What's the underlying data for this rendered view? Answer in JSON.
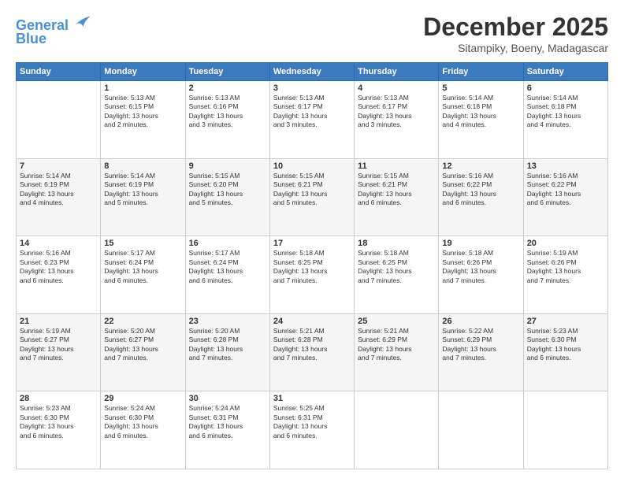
{
  "header": {
    "logo_line1": "General",
    "logo_line2": "Blue",
    "month": "December 2025",
    "location": "Sitampiky, Boeny, Madagascar"
  },
  "weekdays": [
    "Sunday",
    "Monday",
    "Tuesday",
    "Wednesday",
    "Thursday",
    "Friday",
    "Saturday"
  ],
  "weeks": [
    [
      {
        "day": "",
        "info": ""
      },
      {
        "day": "1",
        "info": "Sunrise: 5:13 AM\nSunset: 6:15 PM\nDaylight: 13 hours\nand 2 minutes."
      },
      {
        "day": "2",
        "info": "Sunrise: 5:13 AM\nSunset: 6:16 PM\nDaylight: 13 hours\nand 3 minutes."
      },
      {
        "day": "3",
        "info": "Sunrise: 5:13 AM\nSunset: 6:17 PM\nDaylight: 13 hours\nand 3 minutes."
      },
      {
        "day": "4",
        "info": "Sunrise: 5:13 AM\nSunset: 6:17 PM\nDaylight: 13 hours\nand 3 minutes."
      },
      {
        "day": "5",
        "info": "Sunrise: 5:14 AM\nSunset: 6:18 PM\nDaylight: 13 hours\nand 4 minutes."
      },
      {
        "day": "6",
        "info": "Sunrise: 5:14 AM\nSunset: 6:18 PM\nDaylight: 13 hours\nand 4 minutes."
      }
    ],
    [
      {
        "day": "7",
        "info": "Sunrise: 5:14 AM\nSunset: 6:19 PM\nDaylight: 13 hours\nand 4 minutes."
      },
      {
        "day": "8",
        "info": "Sunrise: 5:14 AM\nSunset: 6:19 PM\nDaylight: 13 hours\nand 5 minutes."
      },
      {
        "day": "9",
        "info": "Sunrise: 5:15 AM\nSunset: 6:20 PM\nDaylight: 13 hours\nand 5 minutes."
      },
      {
        "day": "10",
        "info": "Sunrise: 5:15 AM\nSunset: 6:21 PM\nDaylight: 13 hours\nand 5 minutes."
      },
      {
        "day": "11",
        "info": "Sunrise: 5:15 AM\nSunset: 6:21 PM\nDaylight: 13 hours\nand 6 minutes."
      },
      {
        "day": "12",
        "info": "Sunrise: 5:16 AM\nSunset: 6:22 PM\nDaylight: 13 hours\nand 6 minutes."
      },
      {
        "day": "13",
        "info": "Sunrise: 5:16 AM\nSunset: 6:22 PM\nDaylight: 13 hours\nand 6 minutes."
      }
    ],
    [
      {
        "day": "14",
        "info": "Sunrise: 5:16 AM\nSunset: 6:23 PM\nDaylight: 13 hours\nand 6 minutes."
      },
      {
        "day": "15",
        "info": "Sunrise: 5:17 AM\nSunset: 6:24 PM\nDaylight: 13 hours\nand 6 minutes."
      },
      {
        "day": "16",
        "info": "Sunrise: 5:17 AM\nSunset: 6:24 PM\nDaylight: 13 hours\nand 6 minutes."
      },
      {
        "day": "17",
        "info": "Sunrise: 5:18 AM\nSunset: 6:25 PM\nDaylight: 13 hours\nand 7 minutes."
      },
      {
        "day": "18",
        "info": "Sunrise: 5:18 AM\nSunset: 6:25 PM\nDaylight: 13 hours\nand 7 minutes."
      },
      {
        "day": "19",
        "info": "Sunrise: 5:18 AM\nSunset: 6:26 PM\nDaylight: 13 hours\nand 7 minutes."
      },
      {
        "day": "20",
        "info": "Sunrise: 5:19 AM\nSunset: 6:26 PM\nDaylight: 13 hours\nand 7 minutes."
      }
    ],
    [
      {
        "day": "21",
        "info": "Sunrise: 5:19 AM\nSunset: 6:27 PM\nDaylight: 13 hours\nand 7 minutes."
      },
      {
        "day": "22",
        "info": "Sunrise: 5:20 AM\nSunset: 6:27 PM\nDaylight: 13 hours\nand 7 minutes."
      },
      {
        "day": "23",
        "info": "Sunrise: 5:20 AM\nSunset: 6:28 PM\nDaylight: 13 hours\nand 7 minutes."
      },
      {
        "day": "24",
        "info": "Sunrise: 5:21 AM\nSunset: 6:28 PM\nDaylight: 13 hours\nand 7 minutes."
      },
      {
        "day": "25",
        "info": "Sunrise: 5:21 AM\nSunset: 6:29 PM\nDaylight: 13 hours\nand 7 minutes."
      },
      {
        "day": "26",
        "info": "Sunrise: 5:22 AM\nSunset: 6:29 PM\nDaylight: 13 hours\nand 7 minutes."
      },
      {
        "day": "27",
        "info": "Sunrise: 5:23 AM\nSunset: 6:30 PM\nDaylight: 13 hours\nand 6 minutes."
      }
    ],
    [
      {
        "day": "28",
        "info": "Sunrise: 5:23 AM\nSunset: 6:30 PM\nDaylight: 13 hours\nand 6 minutes."
      },
      {
        "day": "29",
        "info": "Sunrise: 5:24 AM\nSunset: 6:30 PM\nDaylight: 13 hours\nand 6 minutes."
      },
      {
        "day": "30",
        "info": "Sunrise: 5:24 AM\nSunset: 6:31 PM\nDaylight: 13 hours\nand 6 minutes."
      },
      {
        "day": "31",
        "info": "Sunrise: 5:25 AM\nSunset: 6:31 PM\nDaylight: 13 hours\nand 6 minutes."
      },
      {
        "day": "",
        "info": ""
      },
      {
        "day": "",
        "info": ""
      },
      {
        "day": "",
        "info": ""
      }
    ]
  ]
}
